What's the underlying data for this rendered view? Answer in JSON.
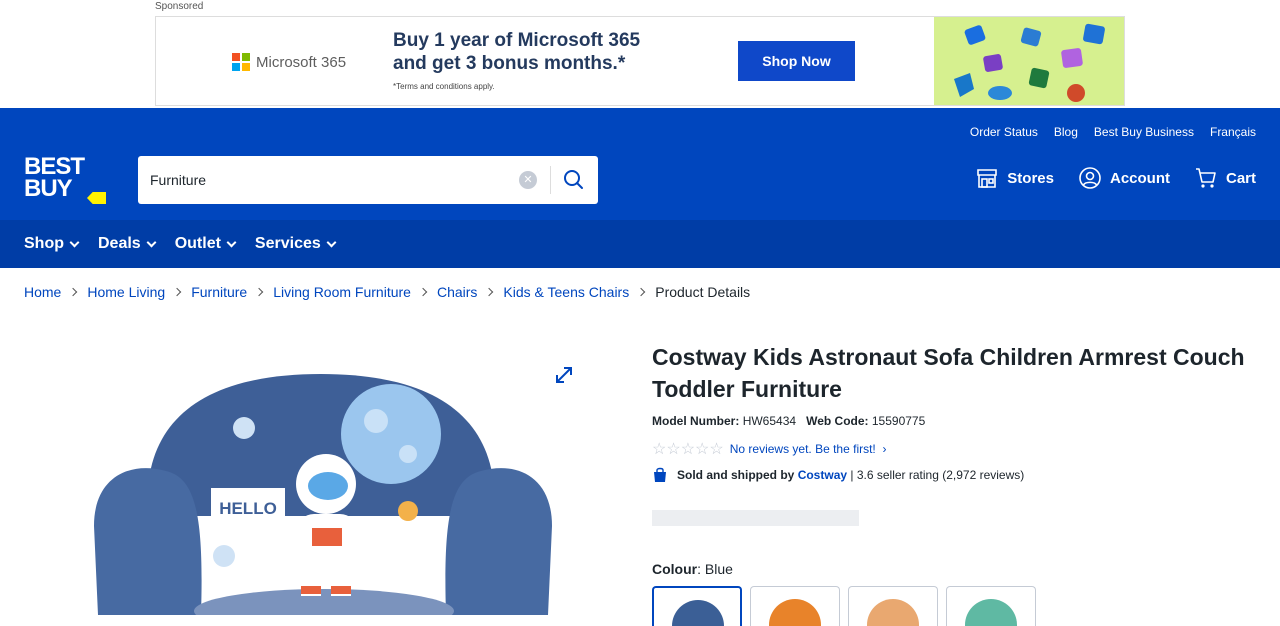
{
  "ad": {
    "label": "Sponsored",
    "brand": "Microsoft 365",
    "headline_line1": "Buy 1 year of Microsoft 365",
    "headline_line2": "and get 3 bonus months.*",
    "terms": "*Terms and conditions apply.",
    "cta": "Shop Now"
  },
  "header": {
    "utility_links": [
      "Order Status",
      "Blog",
      "Best Buy Business",
      "Français"
    ],
    "logo_line1": "BEST",
    "logo_line2": "BUY",
    "search_value": "Furniture",
    "stores": "Stores",
    "account": "Account",
    "cart": "Cart"
  },
  "nav": {
    "items": [
      "Shop",
      "Deals",
      "Outlet",
      "Services"
    ]
  },
  "breadcrumb": [
    "Home",
    "Home Living",
    "Furniture",
    "Living Room Furniture",
    "Chairs",
    "Kids & Teens Chairs",
    "Product Details"
  ],
  "product": {
    "title": "Costway Kids Astronaut Sofa Children Armrest Couch Toddler Furniture",
    "model_label": "Model Number:",
    "model_value": "HW65434",
    "web_code_label": "Web Code:",
    "web_code_value": "15590775",
    "reviews_text": "No reviews yet. Be the first!",
    "seller_prefix": "Sold and shipped by",
    "seller_name": "Costway",
    "seller_rating": "| 3.6 seller rating (2,972 reviews)",
    "colour_label": "Colour",
    "colour_value": "Blue",
    "image_sign_text": "HELLO"
  },
  "colors": {
    "brand_blue": "#0046be",
    "nav_blue": "#003da6",
    "logo_yellow": "#fff200",
    "link_blue": "#0046be",
    "ad_button": "#0f48c9"
  },
  "swatches": [
    {
      "name": "swatch-blue-astronaut",
      "color": "#3b5f96",
      "selected": true
    },
    {
      "name": "swatch-orange-tiger",
      "color": "#e8832a",
      "selected": false
    },
    {
      "name": "swatch-white-pattern",
      "color": "#e9a870",
      "selected": false
    },
    {
      "name": "swatch-green-dino",
      "color": "#5fb9a3",
      "selected": false
    }
  ]
}
